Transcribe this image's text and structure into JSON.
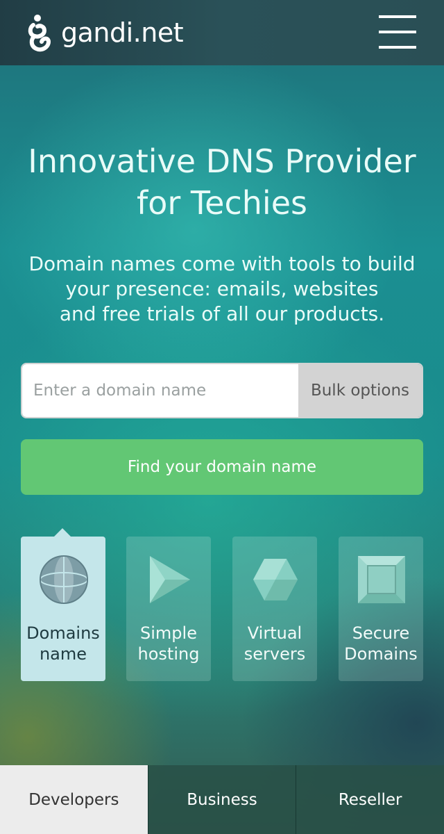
{
  "header": {
    "logo_text": "gandi.net",
    "menu_icon": "hamburger-menu-icon"
  },
  "hero": {
    "title_line1": "Innovative DNS Provider",
    "title_line2": "for Techies",
    "subtitle_line1": "Domain names come with tools to build",
    "subtitle_line2": "your presence: emails, websites",
    "subtitle_line3": "and free trials of all our products."
  },
  "search": {
    "placeholder": "Enter a domain name",
    "value": "",
    "bulk_label": "Bulk options",
    "find_label": "Find your domain name"
  },
  "products": [
    {
      "line1": "Domains",
      "line2": "name",
      "icon": "globe-icon",
      "active": true
    },
    {
      "line1": "Simple",
      "line2": "hosting",
      "icon": "play-icon",
      "active": false
    },
    {
      "line1": "Virtual",
      "line2": "servers",
      "icon": "cube-icon",
      "active": false
    },
    {
      "line1": "Secure",
      "line2": "Domains",
      "icon": "square-frame-icon",
      "active": false
    }
  ],
  "tabs": [
    {
      "label": "Developers",
      "active": true
    },
    {
      "label": "Business",
      "active": false
    },
    {
      "label": "Reseller",
      "active": false
    }
  ],
  "colors": {
    "accent_green": "#62c774",
    "active_product": "#c4e6ea",
    "header": "#213d45"
  }
}
